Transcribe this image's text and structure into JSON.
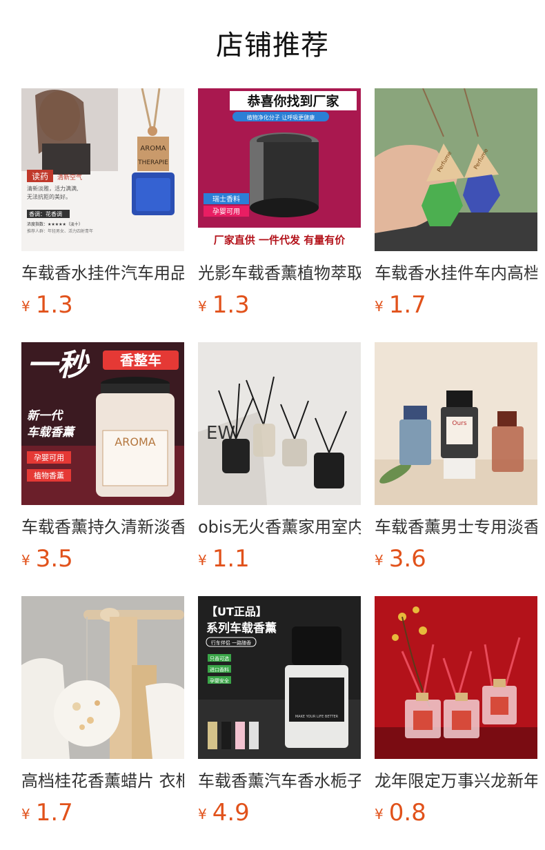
{
  "header": {
    "title": "店铺推荐"
  },
  "products": [
    {
      "name": "车载香水挂件汽车用品",
      "currency": "¥",
      "price": "1.3",
      "image_text": {
        "badge": "读药",
        "sub": "清新空气",
        "bottle": "AROMA THERAPIE",
        "desc1": "清新淡雅，活力满满,",
        "desc2": "无法抗拒的美好。",
        "tag": "香调：花香调",
        "rating_label": "浓度指数：★★★★★（淡十）",
        "rec": "推荐人群：年轻男女、活力四射青年"
      },
      "image_colors": {
        "bg": "#f3f1ef",
        "accent": "#c0392b",
        "bottle": "#2b4fb3"
      }
    },
    {
      "name": "光影车载香薰植物萃取",
      "currency": "¥",
      "price": "1.3",
      "image_text": {
        "headline": "恭喜你找到厂家",
        "sub": "植物净化分子 让呼吸更健康",
        "tag1": "瑞士香料",
        "tag2": "孕婴可用",
        "footer": "厂家直供 一件代发 有量有价"
      },
      "image_colors": {
        "bg": "#d81b60",
        "accent": "#1a1a1a"
      }
    },
    {
      "name": "车载香水挂件车内高档",
      "currency": "¥",
      "price": "1.7",
      "image_text": {
        "label": "Perfume"
      },
      "image_colors": {
        "bg": "#9fb78f"
      }
    },
    {
      "name": "车载香薰持久清新淡香",
      "currency": "¥",
      "price": "3.5",
      "image_text": {
        "big": "一秒",
        "small": "香整车",
        "new1": "新一代",
        "new2": "车载香薰",
        "bottle": "AROMA",
        "tag1": "孕婴可用",
        "tag2": "植物香薰"
      },
      "image_colors": {
        "bg": "#4a1d26",
        "accent": "#e53935"
      }
    },
    {
      "name": "obis无火香薰家用室内",
      "currency": "¥",
      "price": "1.1",
      "image_text": {
        "word": "EW"
      },
      "image_colors": {
        "bg": "#e8e6e3"
      }
    },
    {
      "name": "车载香薰男士专用淡香",
      "currency": "¥",
      "price": "3.6",
      "image_text": {
        "brand": "Ours"
      },
      "image_colors": {
        "bg": "#efe4d6"
      }
    },
    {
      "name": "高档桂花香薰蜡片 衣柜",
      "currency": "¥",
      "price": "1.7",
      "image_text": {},
      "image_colors": {
        "bg": "#b9b7b2"
      }
    },
    {
      "name": "车载香薰汽车香水栀子",
      "currency": "¥",
      "price": "4.9",
      "image_text": {
        "headline": "【UT正品】",
        "title": "系列车载香薰",
        "pill": "行车伴侣 一路随香",
        "opt1": "只香可选",
        "opt2": "进口香料",
        "opt3": "孕婴安全",
        "bottle": "MAKE YOUR LIFE BETTER"
      },
      "image_colors": {
        "bg": "#1f1f1f"
      }
    },
    {
      "name": "龙年限定万事兴龙新年",
      "currency": "¥",
      "price": "0.8",
      "image_text": {},
      "image_colors": {
        "bg": "#b3121a"
      }
    }
  ]
}
